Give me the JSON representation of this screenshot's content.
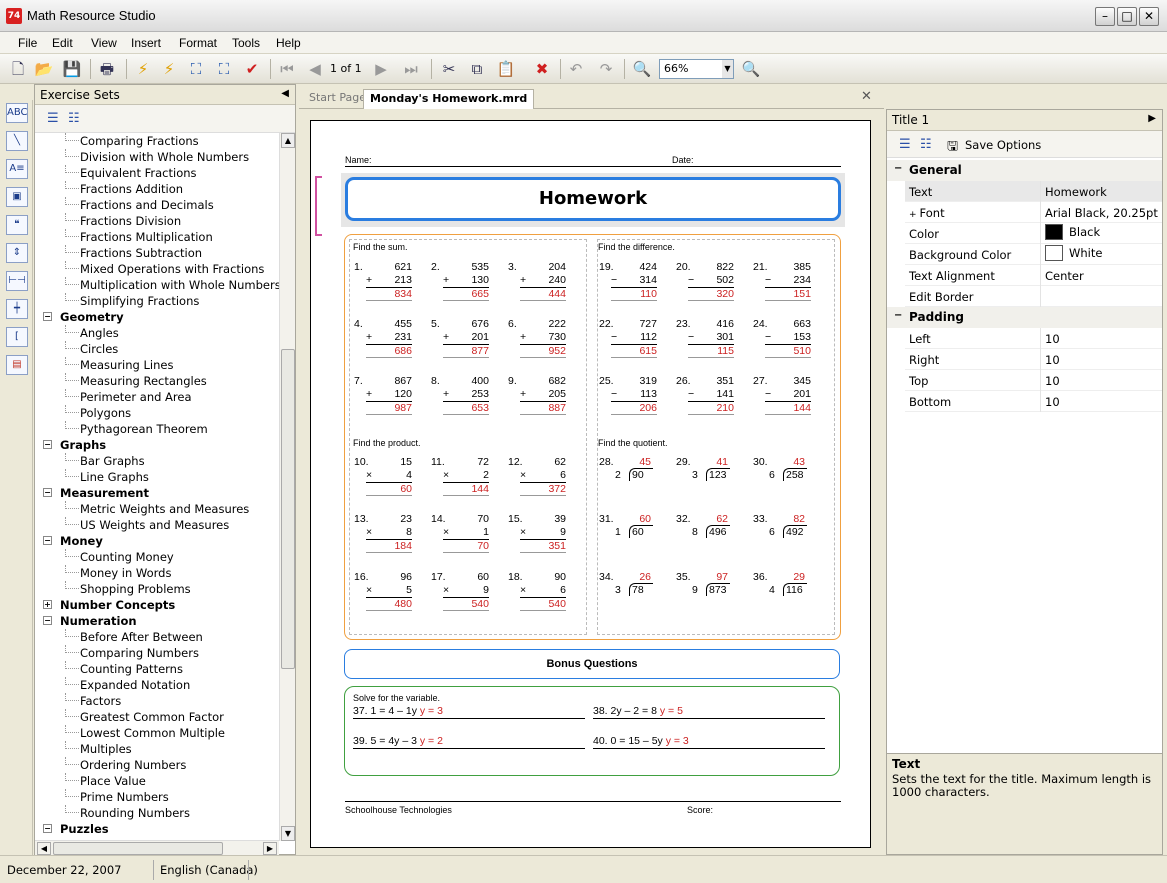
{
  "window": {
    "title": "Math Resource Studio",
    "app_icon": "74"
  },
  "menu": [
    "File",
    "Edit",
    "View",
    "Insert",
    "Format",
    "Tools",
    "Help"
  ],
  "toolbar": {
    "page_counter": "1 of 1",
    "zoom": "66%"
  },
  "sidebar": {
    "title": "Exercise Sets",
    "tree": [
      {
        "label": "Comparing Fractions",
        "level": 2
      },
      {
        "label": "Division with Whole Numbers",
        "level": 2
      },
      {
        "label": "Equivalent Fractions",
        "level": 2
      },
      {
        "label": "Fractions Addition",
        "level": 2
      },
      {
        "label": "Fractions and Decimals",
        "level": 2
      },
      {
        "label": "Fractions Division",
        "level": 2
      },
      {
        "label": "Fractions Multiplication",
        "level": 2
      },
      {
        "label": "Fractions Subtraction",
        "level": 2
      },
      {
        "label": "Mixed Operations with Fractions",
        "level": 2
      },
      {
        "label": "Multiplication with Whole Numbers",
        "level": 2
      },
      {
        "label": "Simplifying Fractions",
        "level": 2
      },
      {
        "label": "Geometry",
        "level": 1,
        "expanded": true
      },
      {
        "label": "Angles",
        "level": 2
      },
      {
        "label": "Circles",
        "level": 2
      },
      {
        "label": "Measuring Lines",
        "level": 2
      },
      {
        "label": "Measuring Rectangles",
        "level": 2
      },
      {
        "label": "Perimeter and Area",
        "level": 2
      },
      {
        "label": "Polygons",
        "level": 2
      },
      {
        "label": "Pythagorean Theorem",
        "level": 2
      },
      {
        "label": "Graphs",
        "level": 1,
        "expanded": true
      },
      {
        "label": "Bar Graphs",
        "level": 2
      },
      {
        "label": "Line Graphs",
        "level": 2
      },
      {
        "label": "Measurement",
        "level": 1,
        "expanded": true
      },
      {
        "label": "Metric Weights and Measures",
        "level": 2
      },
      {
        "label": "US Weights and Measures",
        "level": 2
      },
      {
        "label": "Money",
        "level": 1,
        "expanded": true
      },
      {
        "label": "Counting Money",
        "level": 2
      },
      {
        "label": "Money in Words",
        "level": 2
      },
      {
        "label": "Shopping Problems",
        "level": 2
      },
      {
        "label": "Number Concepts",
        "level": 1,
        "expanded": false
      },
      {
        "label": "Numeration",
        "level": 1,
        "expanded": true
      },
      {
        "label": "Before After Between",
        "level": 2
      },
      {
        "label": "Comparing Numbers",
        "level": 2
      },
      {
        "label": "Counting Patterns",
        "level": 2
      },
      {
        "label": "Expanded Notation",
        "level": 2
      },
      {
        "label": "Factors",
        "level": 2
      },
      {
        "label": "Greatest Common Factor",
        "level": 2
      },
      {
        "label": "Lowest Common Multiple",
        "level": 2
      },
      {
        "label": "Multiples",
        "level": 2
      },
      {
        "label": "Ordering Numbers",
        "level": 2
      },
      {
        "label": "Place Value",
        "level": 2
      },
      {
        "label": "Prime Numbers",
        "level": 2
      },
      {
        "label": "Rounding Numbers",
        "level": 2
      },
      {
        "label": "Puzzles",
        "level": 1,
        "expanded": true
      }
    ]
  },
  "tabs": {
    "start": "Start Page",
    "active": "Monday's Homework.mrd"
  },
  "worksheet": {
    "name_label": "Name:",
    "date_label": "Date:",
    "title": "Homework",
    "sum_label": "Find the sum.",
    "diff_label": "Find the difference.",
    "prod_label": "Find the product.",
    "quot_label": "Find the quotient.",
    "sum": [
      {
        "n": "1.",
        "a": "621",
        "op": "+",
        "b": "213",
        "c": "834"
      },
      {
        "n": "2.",
        "a": "535",
        "op": "+",
        "b": "130",
        "c": "665"
      },
      {
        "n": "3.",
        "a": "204",
        "op": "+",
        "b": "240",
        "c": "444"
      },
      {
        "n": "4.",
        "a": "455",
        "op": "+",
        "b": "231",
        "c": "686"
      },
      {
        "n": "5.",
        "a": "676",
        "op": "+",
        "b": "201",
        "c": "877"
      },
      {
        "n": "6.",
        "a": "222",
        "op": "+",
        "b": "730",
        "c": "952"
      },
      {
        "n": "7.",
        "a": "867",
        "op": "+",
        "b": "120",
        "c": "987"
      },
      {
        "n": "8.",
        "a": "400",
        "op": "+",
        "b": "253",
        "c": "653"
      },
      {
        "n": "9.",
        "a": "682",
        "op": "+",
        "b": "205",
        "c": "887"
      }
    ],
    "diff": [
      {
        "n": "19.",
        "a": "424",
        "op": "−",
        "b": "314",
        "c": "110"
      },
      {
        "n": "20.",
        "a": "822",
        "op": "−",
        "b": "502",
        "c": "320"
      },
      {
        "n": "21.",
        "a": "385",
        "op": "−",
        "b": "234",
        "c": "151"
      },
      {
        "n": "22.",
        "a": "727",
        "op": "−",
        "b": "112",
        "c": "615"
      },
      {
        "n": "23.",
        "a": "416",
        "op": "−",
        "b": "301",
        "c": "115"
      },
      {
        "n": "24.",
        "a": "663",
        "op": "−",
        "b": "153",
        "c": "510"
      },
      {
        "n": "25.",
        "a": "319",
        "op": "−",
        "b": "113",
        "c": "206"
      },
      {
        "n": "26.",
        "a": "351",
        "op": "−",
        "b": "141",
        "c": "210"
      },
      {
        "n": "27.",
        "a": "345",
        "op": "−",
        "b": "201",
        "c": "144"
      }
    ],
    "prod": [
      {
        "n": "10.",
        "a": "15",
        "op": "×",
        "b": "4",
        "c": "60"
      },
      {
        "n": "11.",
        "a": "72",
        "op": "×",
        "b": "2",
        "c": "144"
      },
      {
        "n": "12.",
        "a": "62",
        "op": "×",
        "b": "6",
        "c": "372"
      },
      {
        "n": "13.",
        "a": "23",
        "op": "×",
        "b": "8",
        "c": "184"
      },
      {
        "n": "14.",
        "a": "70",
        "op": "×",
        "b": "1",
        "c": "70"
      },
      {
        "n": "15.",
        "a": "39",
        "op": "×",
        "b": "9",
        "c": "351"
      },
      {
        "n": "16.",
        "a": "96",
        "op": "×",
        "b": "5",
        "c": "480"
      },
      {
        "n": "17.",
        "a": "60",
        "op": "×",
        "b": "9",
        "c": "540"
      },
      {
        "n": "18.",
        "a": "90",
        "op": "×",
        "b": "6",
        "c": "540"
      }
    ],
    "quot": [
      {
        "n": "28.",
        "q": "45",
        "dv": "2",
        "dd": "90"
      },
      {
        "n": "29.",
        "q": "41",
        "dv": "3",
        "dd": "123"
      },
      {
        "n": "30.",
        "q": "43",
        "dv": "6",
        "dd": "258"
      },
      {
        "n": "31.",
        "q": "60",
        "dv": "1",
        "dd": "60"
      },
      {
        "n": "32.",
        "q": "62",
        "dv": "8",
        "dd": "496"
      },
      {
        "n": "33.",
        "q": "82",
        "dv": "6",
        "dd": "492"
      },
      {
        "n": "34.",
        "q": "26",
        "dv": "3",
        "dd": "78"
      },
      {
        "n": "35.",
        "q": "97",
        "dv": "9",
        "dd": "873"
      },
      {
        "n": "36.",
        "q": "29",
        "dv": "4",
        "dd": "116"
      }
    ],
    "bonus_title": "Bonus Questions",
    "solve_label": "Solve for the variable.",
    "equations": [
      {
        "n": "37.",
        "eq": "1 = 4 – 1y",
        "ans": "y = 3"
      },
      {
        "n": "38.",
        "eq": "2y – 2 = 8",
        "ans": "y = 5"
      },
      {
        "n": "39.",
        "eq": "5 = 4y – 3",
        "ans": "y = 2"
      },
      {
        "n": "40.",
        "eq": "0 = 15 – 5y",
        "ans": "y = 3"
      }
    ],
    "footer_left": "Schoolhouse Technologies",
    "footer_right": "Score:"
  },
  "properties": {
    "title": "Title 1",
    "save_options": "Save Options",
    "general": "General",
    "padding": "Padding",
    "rows": [
      {
        "k": "Text",
        "v": "Homework"
      },
      {
        "k": "Font",
        "v": "Arial Black, 20.25pt"
      },
      {
        "k": "Color",
        "v": "Black",
        "swatch": "#000000"
      },
      {
        "k": "Background Color",
        "v": "White",
        "swatch": "#ffffff"
      },
      {
        "k": "Text Alignment",
        "v": "Center"
      },
      {
        "k": "Edit Border",
        "v": ""
      }
    ],
    "pad_rows": [
      {
        "k": "Left",
        "v": "10"
      },
      {
        "k": "Right",
        "v": "10"
      },
      {
        "k": "Top",
        "v": "10"
      },
      {
        "k": "Bottom",
        "v": "10"
      }
    ],
    "help_title": "Text",
    "help_text": "Sets the text for the title. Maximum length is 1000 characters."
  },
  "status": {
    "date": "December 22, 2007",
    "language": "English (Canada)"
  }
}
